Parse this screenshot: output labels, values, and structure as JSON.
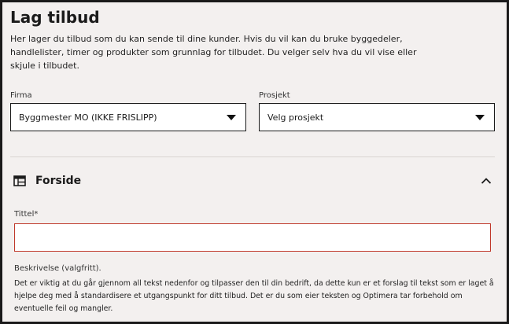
{
  "page": {
    "title": "Lag tilbud",
    "intro": "Her lager du tilbud som du kan sende til dine kunder. Hvis du vil kan du bruke byggedeler, handlelister, timer og produkter som grunnlag for tilbudet. Du velger selv hva du vil vise eller skjule i tilbudet."
  },
  "firma": {
    "label": "Firma",
    "value": "Byggmester MO (IKKE FRISLIPP)"
  },
  "prosjekt": {
    "label": "Prosjekt",
    "value": "Velg prosjekt"
  },
  "forside": {
    "title": "Forside",
    "icon": "table-icon",
    "expanded": true,
    "tittel_label": "Tittel*",
    "tittel_value": "",
    "beskrivelse_label": "Beskrivelse (valgfritt).",
    "help_text": "Det er viktig at du går gjennom all tekst nedenfor og tilpasser den til din bedrift, da dette kun er et forslag til tekst som er laget å hjelpe deg med å standardisere et utgangspunkt for ditt tilbud. Det er du som eier teksten og Optimera tar forbehold om eventuelle feil og mangler."
  },
  "colors": {
    "background": "#f3f0ef",
    "error_border": "#c0392b"
  }
}
